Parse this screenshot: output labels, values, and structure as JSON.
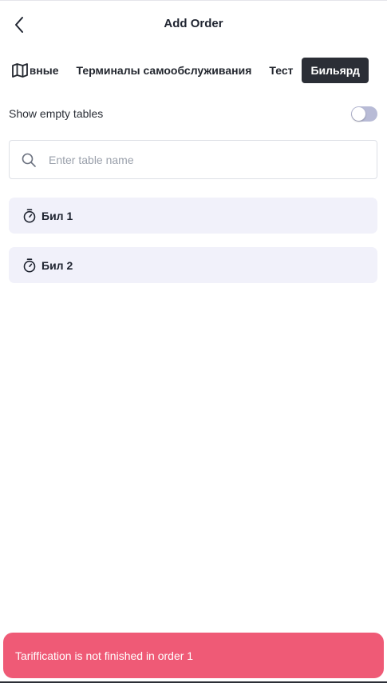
{
  "header": {
    "title": "Add Order"
  },
  "tabs": {
    "items": [
      {
        "label": "Основные"
      },
      {
        "label": "Терминалы самообслуживания"
      },
      {
        "label": "Тест"
      },
      {
        "label": "Бильярд",
        "active": true
      }
    ]
  },
  "filters": {
    "show_empty_label": "Show empty tables",
    "show_empty_enabled": false
  },
  "search": {
    "placeholder": "Enter table name",
    "value": ""
  },
  "tables": [
    {
      "name": "Бил 1"
    },
    {
      "name": "Бил 2"
    }
  ],
  "toast": {
    "message": "Tariffication is not finished in order 1"
  },
  "colors": {
    "active_tab_bg": "#2b2e36",
    "card_bg": "#f1f1fa",
    "toggle_track": "#b8bbd6",
    "toast_bg": "#ef5a76"
  }
}
